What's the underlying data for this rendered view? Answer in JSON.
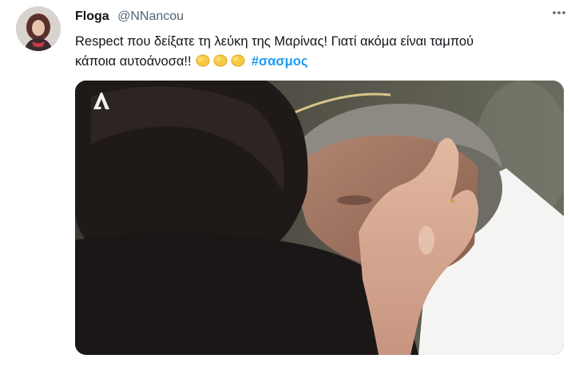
{
  "tweet": {
    "display_name": "Floga",
    "handle": "@NNancou",
    "more_icon": "more-horizontal-icon",
    "text_line_1": "Respect που δείξατε τη λεύκη της Μαρίνας! Γιατί ακόμα είναι ταμπού",
    "text_line_2": "κάποια αυτοάνοσα!!",
    "emoji": "clapping-hands x3",
    "hashtag": "#σασμος",
    "hashtag_color": "#1d9bf0"
  },
  "media": {
    "channel_logo": "alpha-tv-logo"
  }
}
